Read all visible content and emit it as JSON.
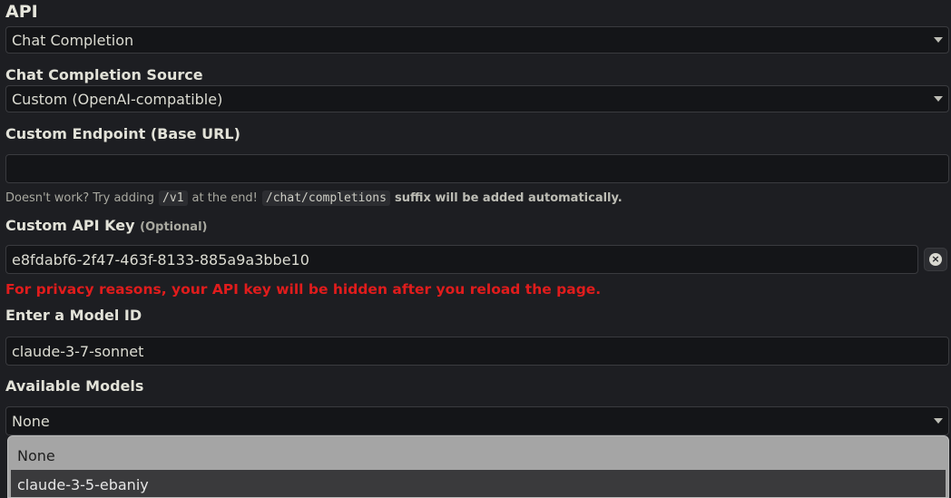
{
  "api": {
    "title": "API",
    "value": "Chat Completion"
  },
  "source": {
    "label": "Chat Completion Source",
    "value": "Custom (OpenAI-compatible)"
  },
  "endpoint": {
    "label": "Custom Endpoint (Base URL)",
    "value": "",
    "hint_prefix": "Doesn't work? Try adding",
    "hint_code1": "/v1",
    "hint_mid": "at the end!",
    "hint_code2": "/chat/completions",
    "hint_suffix": "suffix will be added automatically."
  },
  "api_key": {
    "label": "Custom API Key",
    "optional": "(Optional)",
    "value": "e8fdabf6-2f47-463f-8133-885a9a3bbe10",
    "clear_icon": "close-circle-icon",
    "warning": "For privacy reasons, your API key will be hidden after you reload the page."
  },
  "model_id": {
    "label": "Enter a Model ID",
    "value": "claude-3-7-sonnet"
  },
  "available_models": {
    "label": "Available Models",
    "value": "None",
    "options": [
      "None",
      "claude-3-5-ebaniy"
    ],
    "highlighted_option": "claude-3-5-ebaniy"
  }
}
